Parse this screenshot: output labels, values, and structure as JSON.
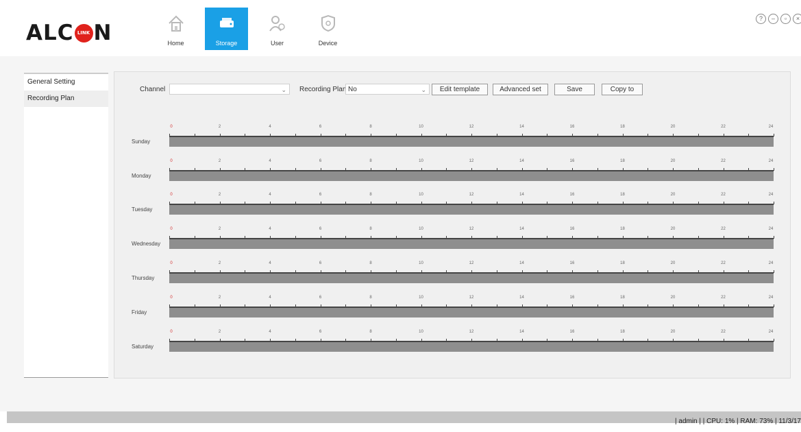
{
  "app": {
    "logo_text_left": "ALC",
    "logo_disc_text": "LINK",
    "logo_text_right": "N",
    "accent_color": "#1aa0e6",
    "logo_red": "#e0221c"
  },
  "nav": [
    {
      "label": "Home",
      "icon": "home-icon",
      "active": false
    },
    {
      "label": "Storage",
      "icon": "storage-icon",
      "active": true
    },
    {
      "label": "User",
      "icon": "user-icon",
      "active": false
    },
    {
      "label": "Device",
      "icon": "device-icon",
      "active": false
    }
  ],
  "window_controls": [
    "help-icon",
    "minimize-icon",
    "restore-icon",
    "close-icon"
  ],
  "sidebar": {
    "items": [
      {
        "label": "General Setting",
        "selected": false
      },
      {
        "label": "Recording Plan",
        "selected": true
      }
    ]
  },
  "toolbar": {
    "channel_label": "Channel",
    "channel_value": "",
    "plan_label": "Recording Plan",
    "plan_value": "No",
    "edit_template": "Edit template",
    "advanced_set": "Advanced set",
    "save": "Save",
    "copy_to": "Copy to"
  },
  "schedule": {
    "days": [
      "Sunday",
      "Monday",
      "Tuesday",
      "Wednesday",
      "Thursday",
      "Friday",
      "Saturday"
    ],
    "hours": [
      "0",
      "2",
      "4",
      "6",
      "8",
      "10",
      "12",
      "14",
      "16",
      "18",
      "20",
      "22",
      "24"
    ]
  },
  "status": {
    "text": "| admin | | CPU: 1% | RAM: 73% | 11/3/17"
  }
}
